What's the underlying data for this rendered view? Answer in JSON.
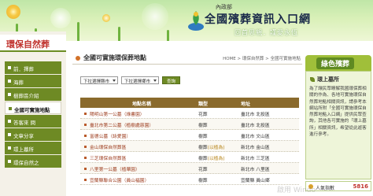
{
  "header": {
    "org": "內政部",
    "title": "全國殯葬資訊入口網",
    "slogan": "回首思親．謹愛永恆"
  },
  "sidebar": {
    "title": "環保自然葬",
    "items": [
      {
        "label": "前．擇葬"
      },
      {
        "label": "海葬"
      },
      {
        "label": "樹葬區介紹"
      },
      {
        "label": "全國可實施地點"
      },
      {
        "label": "答客來 問"
      },
      {
        "label": "文章分享"
      },
      {
        "label": "環上墓所"
      },
      {
        "label": "環保自然之"
      }
    ]
  },
  "main": {
    "heading": "全國可實施環保葬地點",
    "breadcrumb": "HOME > 環保自然葬 > 全國可實施地點",
    "filter_city": "下拉選擇縣市",
    "filter_district": "下拉選擇鄉市",
    "search_label": "查詢",
    "columns": [
      "地點名稱",
      "類型",
      "地址"
    ],
    "rows": [
      {
        "name": "陽明山第一公墓（綠書園）",
        "type": "花葬",
        "address": "臺北市 北投區"
      },
      {
        "name": "臺北市第二公墓（植樹處慈園）",
        "type": "樹葬",
        "address": "臺北市 北投區"
      },
      {
        "name": "富德公墓（詠愛園）",
        "type": "樹葬",
        "address": "臺北市 文山區"
      },
      {
        "name": "金山環保自然葬區",
        "type": "樹葬",
        "tag": "(以植為)",
        "address": "新北市 金山區"
      },
      {
        "name": "三芝環保自然葬區",
        "type": "樹葬",
        "tag": "(以植為)",
        "address": "新北市 三芝區"
      },
      {
        "name": "八里第一公墓（植華園）",
        "type": "花葬",
        "address": "新北市 八里區"
      },
      {
        "name": "宜蘭縣聯合公園（員山福園）",
        "type": "樹葬",
        "address": "宜蘭縣 員山鄉"
      }
    ]
  },
  "right_panel": {
    "tab": "綠色殯葬",
    "heading": "環上墓所",
    "text": "為了讓民眾瞭解我國環保葬相關的作為、各地可實施環保自然葬地點相關資訊，請參考本網站所附「全國可實施環保自然葬地點入口網」提供民眾查詢，其他各可實施的「環上墓所」相關資訊，希望從此遊客進行參考。",
    "counter_label": "人氣指數",
    "counter_value": "5816"
  },
  "watermark": "啟用 Windo"
}
